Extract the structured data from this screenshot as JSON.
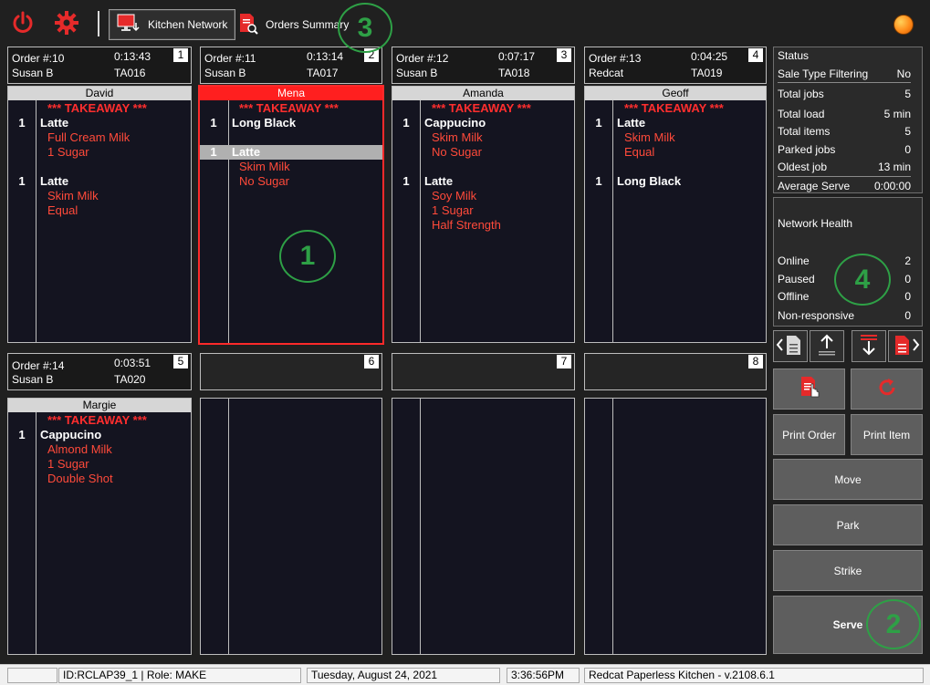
{
  "toolbar": {
    "kitchen_network_label": "Kitchen Network",
    "orders_summary_label": "Orders Summary",
    "status_color": "#ff8c1a"
  },
  "slots": [
    {
      "num": "1",
      "order": "Order #:10",
      "time": "0:13:43",
      "server_name": "Susan B",
      "table": "TA016",
      "customer": "David"
    },
    {
      "num": "2",
      "order": "Order #:11",
      "time": "0:13:14",
      "server_name": "Susan B",
      "table": "TA017",
      "customer": "Mena"
    },
    {
      "num": "3",
      "order": "Order #:12",
      "time": "0:07:17",
      "server_name": "Susan B",
      "table": "TA018",
      "customer": "Amanda"
    },
    {
      "num": "4",
      "order": "Order #:13",
      "time": "0:04:25",
      "server_name": "Redcat",
      "table": "TA019",
      "customer": "Geoff"
    },
    {
      "num": "5",
      "order": "Order #:14",
      "time": "0:03:51",
      "server_name": "Susan B",
      "table": "TA020",
      "customer": "Margie"
    },
    {
      "num": "6"
    },
    {
      "num": "7"
    },
    {
      "num": "8"
    }
  ],
  "tickets": {
    "takeaway": "*** TAKEAWAY ***",
    "t1": {
      "q1": "1",
      "i1": "Latte",
      "m1a": "Full Cream Milk",
      "m1b": "1 Sugar",
      "q2": "1",
      "i2": "Latte",
      "m2a": "Skim Milk",
      "m2b": "Equal"
    },
    "t2": {
      "q1": "1",
      "i1": "Long Black",
      "q2": "1",
      "i2": "Latte",
      "m2a": "Skim Milk",
      "m2b": "No Sugar"
    },
    "t3": {
      "q1": "1",
      "i1": "Cappucino",
      "m1a": "Skim Milk",
      "m1b": "No Sugar",
      "q2": "1",
      "i2": "Latte",
      "m2a": "Soy Milk",
      "m2b": "1 Sugar",
      "m2c": "Half Strength"
    },
    "t4": {
      "q1": "1",
      "i1": "Latte",
      "m1a": "Skim Milk",
      "m1b": "Equal",
      "q2": "1",
      "i2": "Long Black"
    },
    "t5": {
      "q1": "1",
      "i1": "Cappucino",
      "m1a": "Almond Milk",
      "m1b": "1 Sugar",
      "m1c": "Double Shot"
    }
  },
  "status": {
    "title": "Status",
    "rows": [
      {
        "label": "Sale Type Filtering",
        "value": "No"
      },
      {
        "label": "Total jobs",
        "value": "5"
      },
      {
        "label": "Total load",
        "value": "5 min"
      },
      {
        "label": "Total items",
        "value": "5"
      },
      {
        "label": "Parked jobs",
        "value": "0"
      },
      {
        "label": "Oldest job",
        "value": "13 min"
      },
      {
        "label": "Average Serve",
        "value": "0:00:00"
      }
    ]
  },
  "network": {
    "title": "Network Health",
    "rows": [
      {
        "label": "Online",
        "value": "2"
      },
      {
        "label": "Paused",
        "value": "0"
      },
      {
        "label": "Offline",
        "value": "0"
      },
      {
        "label": "Non-responsive",
        "value": "0"
      }
    ]
  },
  "actions": {
    "print_order": "Print Order",
    "print_item": "Print Item",
    "move": "Move",
    "park": "Park",
    "strike": "Strike",
    "serve": "Serve"
  },
  "statusbar": {
    "id_role": "ID:RCLAP39_1 | Role: MAKE",
    "date": "Tuesday, August 24, 2021",
    "time": "3:36:56PM",
    "version": "Redcat Paperless Kitchen - v.2108.6.1"
  },
  "callouts": [
    "1",
    "2",
    "3",
    "4"
  ],
  "colors": {
    "accent_red": "#ff1f1f",
    "modifier_red": "#ff4a3a",
    "callout_green": "#2ea046"
  }
}
